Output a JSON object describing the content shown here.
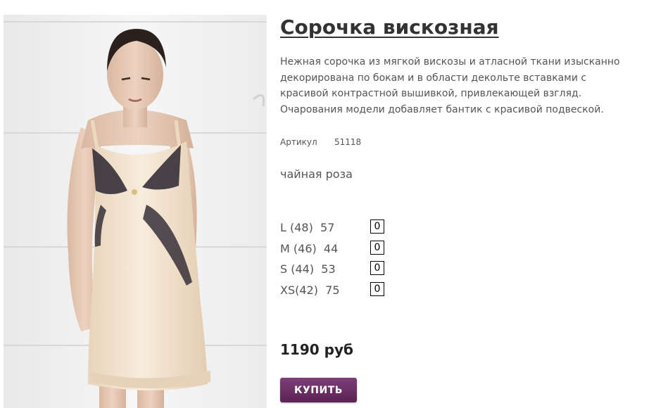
{
  "product": {
    "title": "Сорочка вискозная",
    "description": "Нежная сорочка из мягкой вискозы и атласной ткани изысканно декорирована по бокам и в области декольте вставками с красивой контрастной вышивкой, привлекающей взгляд. Очарования модели добавляет бантик с красивой подвеской.",
    "article_label": "Артикул",
    "article_value": "51118",
    "color": "чайная роза",
    "sizes": [
      {
        "label": "L (48)  57",
        "qty": "0"
      },
      {
        "label": "M (46)  44",
        "qty": "0"
      },
      {
        "label": "S (44)  53",
        "qty": "0"
      },
      {
        "label": "XS(42)  75",
        "qty": "0"
      }
    ],
    "price": "1190 руб",
    "buy_label": "КУПИТЬ"
  },
  "colors": {
    "button": "#6b2f63",
    "dress": "#f3e3cf",
    "lace": "#2a2630"
  }
}
